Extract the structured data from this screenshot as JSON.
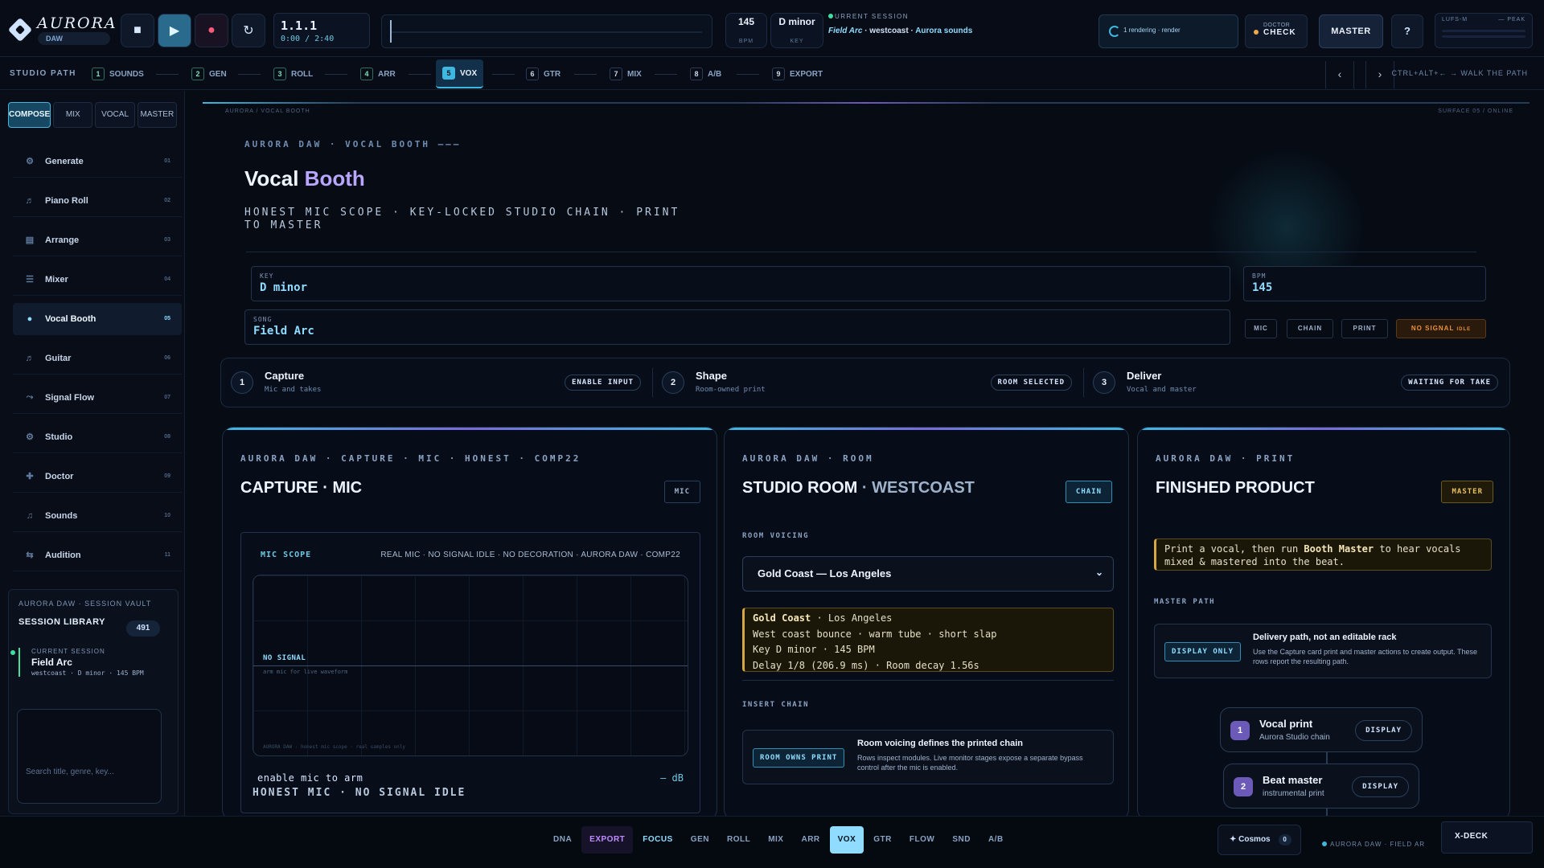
{
  "app": {
    "name": "AURORA",
    "sub": "DAW"
  },
  "transport": {
    "position": "1.1.1",
    "time": "0:00 / 2:40"
  },
  "meters": {
    "bpm_value": "145",
    "bpm_label": "BPM",
    "key_value": "D minor",
    "key_label": "KEY"
  },
  "session_header": {
    "label": "URRENT SESSION",
    "song": "Field Arc",
    "mid": "· westcoast ·",
    "source": "Aurora sounds"
  },
  "render_status": "1 rendering · render",
  "doctor": {
    "top": "DOCTOR",
    "bottom": "CHECK"
  },
  "master_label": "MASTER",
  "help_label": "?",
  "lufs": {
    "left": "LUFS-M",
    "right": "— PEAK"
  },
  "studio_path": {
    "label": "STUDIO PATH",
    "steps": [
      {
        "n": "1",
        "label": "SOUNDS"
      },
      {
        "n": "2",
        "label": "GEN"
      },
      {
        "n": "3",
        "label": "ROLL"
      },
      {
        "n": "4",
        "label": "ARR"
      },
      {
        "n": "5",
        "label": "VOX"
      },
      {
        "n": "6",
        "label": "GTR"
      },
      {
        "n": "7",
        "label": "MIX"
      },
      {
        "n": "8",
        "label": "A/B"
      },
      {
        "n": "9",
        "label": "EXPORT"
      }
    ],
    "prev": "‹",
    "next": "›",
    "hint": "CTRL+ALT+← → WALK THE PATH"
  },
  "modes": [
    "COMPOSE",
    "MIX",
    "VOCAL",
    "MASTER"
  ],
  "nav": [
    {
      "icon": "⚙",
      "label": "Generate",
      "num": "01"
    },
    {
      "icon": "♬",
      "label": "Piano Roll",
      "num": "02"
    },
    {
      "icon": "▤",
      "label": "Arrange",
      "num": "03"
    },
    {
      "icon": "☰",
      "label": "Mixer",
      "num": "04"
    },
    {
      "icon": "●",
      "label": "Vocal Booth",
      "num": "05"
    },
    {
      "icon": "♬",
      "label": "Guitar",
      "num": "06"
    },
    {
      "icon": "⤳",
      "label": "Signal Flow",
      "num": "07"
    },
    {
      "icon": "⚙",
      "label": "Studio",
      "num": "08"
    },
    {
      "icon": "✚",
      "label": "Doctor",
      "num": "09"
    },
    {
      "icon": "♫",
      "label": "Sounds",
      "num": "10"
    },
    {
      "icon": "⇆",
      "label": "Audition",
      "num": "11"
    }
  ],
  "vault": {
    "header": "AURORA DAW · SESSION VAULT",
    "title": "SESSION LIBRARY",
    "count": "491",
    "current_label": "CURRENT SESSION",
    "current_name": "Field Arc",
    "current_meta": "westcoast · D minor · 145 BPM",
    "search_placeholder": "Search title, genre, key..."
  },
  "page": {
    "crumb": "AURORA / VOCAL BOOTH",
    "surface": "SURFACE 05 / ONLINE",
    "eyebrow": "AURORA DAW · VOCAL BOOTH ———",
    "title_a": "Vocal",
    "title_b": "Booth",
    "tagline": "HONEST MIC SCOPE · KEY-LOCKED STUDIO CHAIN · PRINT TO MASTER",
    "key_label": "KEY",
    "key_value": "D minor",
    "bpm_label": "BPM",
    "bpm_value": "145",
    "song_label": "SONG",
    "song_value": "Field Arc",
    "chips": [
      "MIC",
      "CHAIN",
      "PRINT"
    ],
    "warn_chip": "NO SIGNAL",
    "warn_chip_small": "IDLE"
  },
  "workflow": [
    {
      "n": "1",
      "title": "Capture",
      "sub": "Mic and takes",
      "badge": "ENABLE INPUT"
    },
    {
      "n": "2",
      "title": "Shape",
      "sub": "Room-owned print",
      "badge": "ROOM SELECTED"
    },
    {
      "n": "3",
      "title": "Deliver",
      "sub": "Vocal and master",
      "badge": "WAITING FOR TAKE"
    }
  ],
  "capture": {
    "eyebrow": "AURORA DAW · CAPTURE · MIC · HONEST · COMP22",
    "title": "CAPTURE · MIC",
    "badge": "MIC",
    "scope_title": "MIC SCOPE",
    "scope_meta": "REAL MIC · NO SIGNAL IDLE · NO DECORATION · AURORA DAW · COMP22",
    "no_signal": "NO SIGNAL",
    "arm_hint": "arm mic for live waveform",
    "footer": "AURORA DAW · honest mic scope · real samples only",
    "enable": "enable mic to arm",
    "db": "— dB",
    "status": "HONEST MIC · NO SIGNAL IDLE"
  },
  "room": {
    "eyebrow": "AURORA DAW · ROOM",
    "title_a": "STUDIO ROOM",
    "title_b": "· WESTCOAST",
    "badge": "CHAIN",
    "voicing_label": "ROOM VOICING",
    "selected": "Gold Coast — Los Angeles",
    "detail_name": "Gold Coast",
    "detail_place": "· Los Angeles",
    "detail_lines": [
      "West coast bounce · warm tube · short slap",
      "Key D minor · 145 BPM",
      "Delay 1/8 (206.9 ms) · Room decay 1.56s"
    ],
    "insert_label": "INSERT CHAIN",
    "insert_badge": "ROOM OWNS PRINT",
    "insert_title": "Room voicing defines the printed chain",
    "insert_desc": "Rows inspect modules. Live monitor stages expose a separate bypass control after the mic is enabled."
  },
  "print": {
    "eyebrow": "AURORA DAW · PRINT",
    "title": "FINISHED PRODUCT",
    "badge": "MASTER",
    "note_a": "Print a vocal, then run",
    "note_b": "Booth Master",
    "note_c": "to hear vocals mixed & mastered into the beat.",
    "path_label": "MASTER PATH",
    "path_badge": "DISPLAY ONLY",
    "path_title": "Delivery path, not an editable rack",
    "path_desc": "Use the Capture card print and master actions to create output. These rows report the resulting path.",
    "outputs": [
      {
        "n": "1",
        "title": "Vocal print",
        "sub": "Aurora Studio chain",
        "badge": "DISPLAY"
      },
      {
        "n": "2",
        "title": "Beat master",
        "sub": "instrumental print",
        "badge": "DISPLAY"
      }
    ]
  },
  "dock": {
    "items": [
      "DNA",
      "EXPORT",
      "FOCUS",
      "GEN",
      "ROLL",
      "MIX",
      "ARR",
      "VOX",
      "GTR",
      "FLOW",
      "SND",
      "A/B"
    ],
    "cosmos": "✦ Cosmos",
    "cosmos_count": "0",
    "footer": "AURORA DAW · FIELD AR",
    "xdeck": "X-DECK"
  }
}
